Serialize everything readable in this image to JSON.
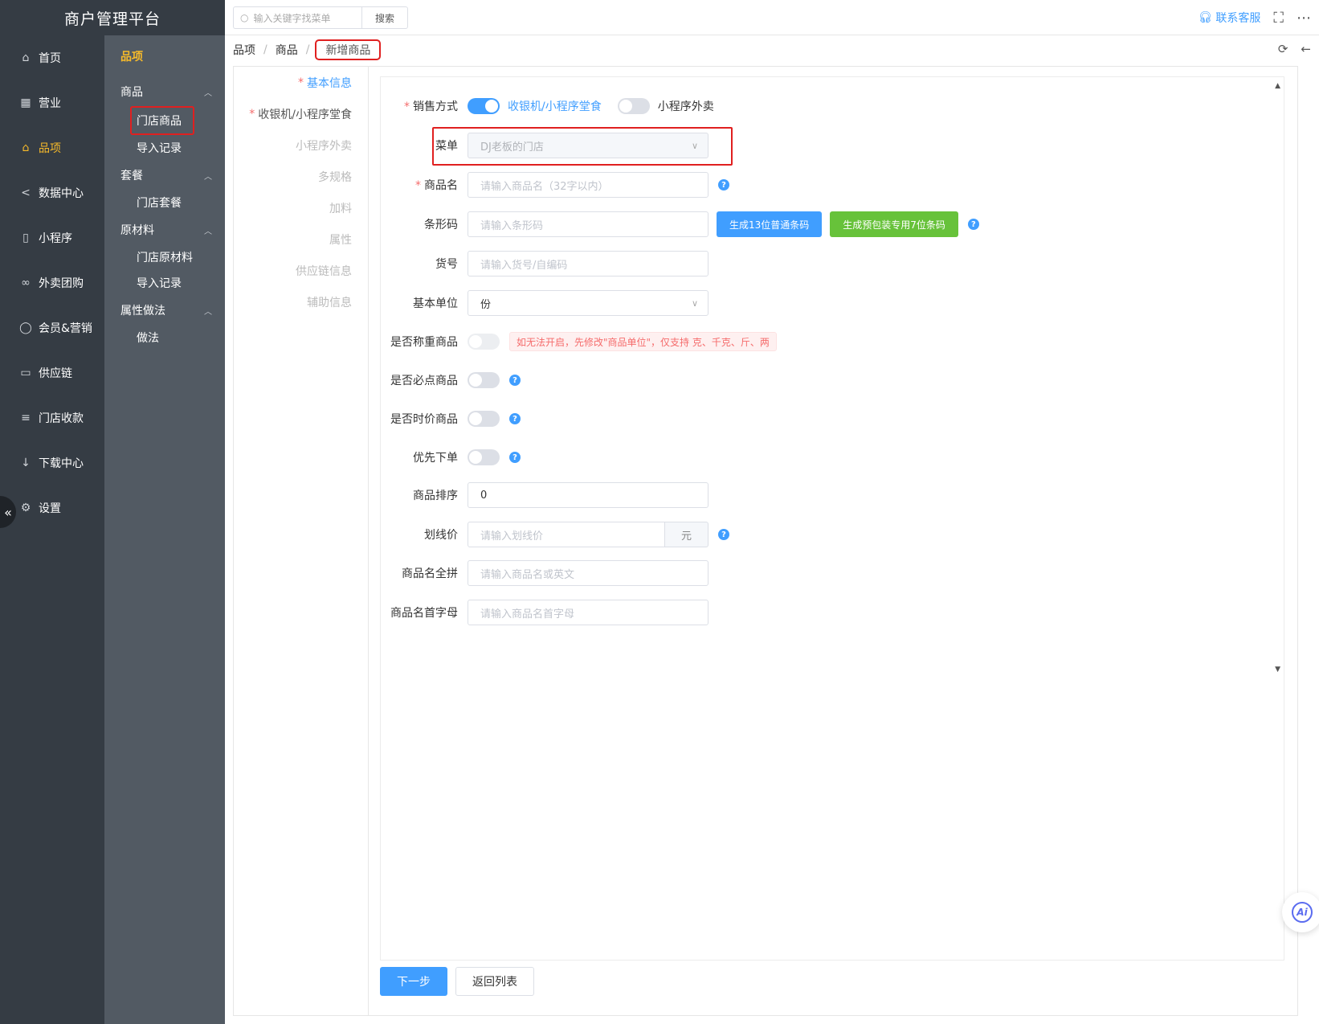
{
  "brand": {
    "title": "商户管理平台"
  },
  "nav": [
    {
      "label": "首页",
      "icon": "home-icon",
      "active": false
    },
    {
      "label": "营业",
      "icon": "calendar-icon",
      "active": false
    },
    {
      "label": "品项",
      "icon": "bag-icon",
      "active": true
    },
    {
      "label": "数据中心",
      "icon": "share-icon",
      "active": false
    },
    {
      "label": "小程序",
      "icon": "phone-icon",
      "active": false
    },
    {
      "label": "外卖团购",
      "icon": "bike-icon",
      "active": false
    },
    {
      "label": "会员&营销",
      "icon": "user-icon",
      "active": false
    },
    {
      "label": "供应链",
      "icon": "truck-icon",
      "active": false
    },
    {
      "label": "门店收款",
      "icon": "database-icon",
      "active": false
    },
    {
      "label": "下载中心",
      "icon": "download-icon",
      "active": false
    },
    {
      "label": "设置",
      "icon": "gear-icon",
      "active": false
    }
  ],
  "subnav": {
    "title": "品项",
    "groups": [
      {
        "label": "商品",
        "items": [
          "门店商品",
          "导入记录"
        ]
      },
      {
        "label": "套餐",
        "items": [
          "门店套餐"
        ]
      },
      {
        "label": "原材料",
        "items": [
          "门店原材料",
          "导入记录"
        ]
      },
      {
        "label": "属性做法",
        "items": [
          "做法"
        ]
      }
    ]
  },
  "topbar": {
    "search_placeholder": "输入关键字找菜单",
    "search_button": "搜索",
    "support": "联系客服"
  },
  "breadcrumb": [
    "品项",
    "商品",
    "新增商品"
  ],
  "steps": [
    {
      "label": "基本信息",
      "required": true
    },
    {
      "label": "收银机/小程序堂食",
      "required": true
    },
    {
      "label": "小程序外卖",
      "required": false
    },
    {
      "label": "多规格",
      "required": false
    },
    {
      "label": "加料",
      "required": false
    },
    {
      "label": "属性",
      "required": false
    },
    {
      "label": "供应链信息",
      "required": false
    },
    {
      "label": "辅助信息",
      "required": false
    }
  ],
  "form": {
    "sale_mode": {
      "label": "销售方式",
      "option1": "收银机/小程序堂食",
      "option2": "小程序外卖"
    },
    "menu": {
      "label": "菜单",
      "value": "DJ老板的门店"
    },
    "name": {
      "label": "商品名",
      "placeholder": "请输入商品名（32字以内）"
    },
    "barcode": {
      "label": "条形码",
      "placeholder": "请输入条形码",
      "btn1": "生成13位普通条码",
      "btn2": "生成预包装专用7位条码"
    },
    "sku": {
      "label": "货号",
      "placeholder": "请输入货号/自编码"
    },
    "unit": {
      "label": "基本单位",
      "value": "份"
    },
    "weighed": {
      "label": "是否称重商品",
      "tip": "如无法开启，先修改\"商品单位\"，仅支持 克、千克、斤、两"
    },
    "must_order": {
      "label": "是否必点商品"
    },
    "market_price": {
      "label": "是否时价商品"
    },
    "priority": {
      "label": "优先下单"
    },
    "sort": {
      "label": "商品排序",
      "value": "0"
    },
    "strike_price": {
      "label": "划线价",
      "placeholder": "请输入划线价",
      "unit": "元"
    },
    "pinyin": {
      "label": "商品名全拼",
      "placeholder": "请输入商品名或英文"
    },
    "initials": {
      "label": "商品名首字母",
      "placeholder": "请输入商品名首字母"
    }
  },
  "footer": {
    "next": "下一步",
    "back": "返回列表"
  },
  "ai": {
    "label": "Ai"
  },
  "colors": {
    "primary": "#409eff",
    "success": "#67c23a",
    "sidebar": "#353c44",
    "sidebar2": "#525a63",
    "accent": "#f7ba2a",
    "highlight": "#e02020"
  }
}
